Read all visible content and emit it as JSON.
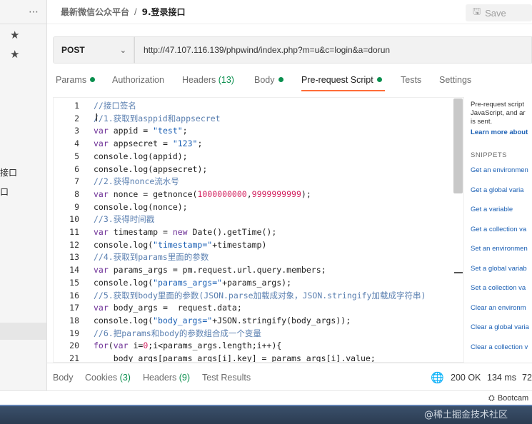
{
  "sidebar": {
    "more_icon": "⋯",
    "star_icon": "★",
    "item_fragment_1": "接口",
    "item_fragment_2": "口"
  },
  "header": {
    "workspace": "最新微信公众平台",
    "separator": "/",
    "request_name": "9.登录接口",
    "save_label": "Save"
  },
  "request": {
    "method": "POST",
    "url": "http://47.107.116.139/phpwind/index.php?m=u&c=login&a=dorun"
  },
  "tabs": [
    {
      "label": "Params",
      "dot": true
    },
    {
      "label": "Authorization"
    },
    {
      "label": "Headers",
      "count": "(13)"
    },
    {
      "label": "Body",
      "dot": true
    },
    {
      "label": "Pre-request Script",
      "dot": true,
      "active": true
    },
    {
      "label": "Tests"
    },
    {
      "label": "Settings"
    }
  ],
  "editor": {
    "lines": [
      {
        "n": "1",
        "text": "//接口签名"
      },
      {
        "n": "2",
        "text": "//1.获取到asppid和appsecret"
      },
      {
        "n": "3",
        "text": "var appid = \"test\";"
      },
      {
        "n": "4",
        "text": "var appsecret = \"123\";"
      },
      {
        "n": "5",
        "text": "console.log(appid);"
      },
      {
        "n": "6",
        "text": "console.log(appsecret);"
      },
      {
        "n": "7",
        "text": "//2.获得nonce流水号"
      },
      {
        "n": "8",
        "text": "var nonce = getnonce(1000000000,9999999999);"
      },
      {
        "n": "9",
        "text": "console.log(nonce);"
      },
      {
        "n": "10",
        "text": "//3.获得时间戳"
      },
      {
        "n": "11",
        "text": "var timestamp = new Date().getTime();"
      },
      {
        "n": "12",
        "text": "console.log(\"timestamp=\"+timestamp)"
      },
      {
        "n": "13",
        "text": "//4.获取到params里面的参数"
      },
      {
        "n": "14",
        "text": "var params_args = pm.request.url.query.members;"
      },
      {
        "n": "15",
        "text": "console.log(\"params_args=\"+params_args);"
      },
      {
        "n": "16",
        "text": "//5.获取到body里面的参数(JSON.parse加载成对象，JSON.stringify加载成字符串)"
      },
      {
        "n": "17",
        "text": "var body_args =  request.data;"
      },
      {
        "n": "18",
        "text": "console.log(\"body_args=\"+JSON.stringify(body_args));"
      },
      {
        "n": "19",
        "text": "//6.把params和body的参数组合成一个变量"
      },
      {
        "n": "20",
        "text": "for(var i=0;i<params_args.length;i++){"
      },
      {
        "n": "21",
        "text": "    body_args[params_args[i].key] = params_args[i].value;"
      }
    ]
  },
  "right_panel": {
    "desc_1": "Pre-request script",
    "desc_2": "JavaScript, and ar",
    "desc_3": "is sent.",
    "learn_more": "Learn more about",
    "snippets_heading": "SNIPPETS",
    "snippets": [
      "Get an environmen",
      "Get a global varia",
      "Get a variable",
      "Get a collection va",
      "Set an environmen",
      "Set a global variab",
      "Set a collection va",
      "Clear an environm",
      "Clear a global varia",
      "Clear a collection v"
    ]
  },
  "response": {
    "tabs": [
      {
        "label": "Body"
      },
      {
        "label": "Cookies",
        "count": "(3)"
      },
      {
        "label": "Headers",
        "count": "(9)"
      },
      {
        "label": "Test Results"
      }
    ],
    "status": "200 OK",
    "time": "134 ms",
    "size": "72"
  },
  "statusbar": {
    "bootcamp": "Bootcam",
    "watermark": "@稀土掘金技术社区"
  },
  "colors": {
    "accent": "#ff6c37",
    "success": "#0a8f4e",
    "link": "#1a5fb4"
  }
}
